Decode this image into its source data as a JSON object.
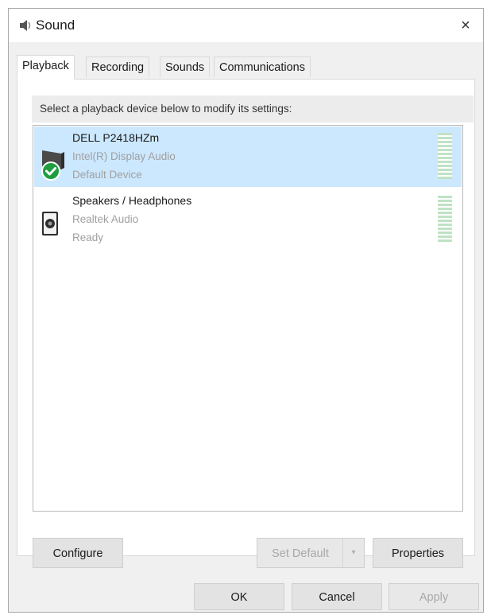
{
  "window": {
    "title": "Sound",
    "close_glyph": "×"
  },
  "tabs": [
    {
      "label": "Playback",
      "active": true
    },
    {
      "label": "Recording",
      "active": false
    },
    {
      "label": "Sounds",
      "active": false
    },
    {
      "label": "Communications",
      "active": false
    }
  ],
  "instruction": "Select a playback device below to modify its settings:",
  "devices": [
    {
      "name": "DELL P2418HZm",
      "driver": "Intel(R) Display Audio",
      "status": "Default Device",
      "selected": true,
      "icon": "monitor-speaker-icon",
      "badge_icon": "default-check-icon"
    },
    {
      "name": "Speakers / Headphones",
      "driver": "Realtek Audio",
      "status": "Ready",
      "selected": false,
      "icon": "speaker-icon"
    }
  ],
  "buttons": {
    "configure": "Configure",
    "set_default": "Set Default",
    "set_default_arrow": "▾",
    "properties": "Properties",
    "ok": "OK",
    "cancel": "Cancel",
    "apply": "Apply"
  },
  "colors": {
    "selection": "#cce8ff",
    "check_badge": "#1e9e3e",
    "level_meter": "#bfe3c5"
  }
}
